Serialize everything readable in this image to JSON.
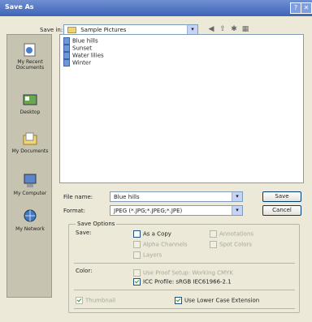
{
  "window": {
    "title": "Save As"
  },
  "toolbar": {
    "save_in_label": "Save in:",
    "save_in_value": "Sample Pictures"
  },
  "places": [
    {
      "label": "My Recent Documents",
      "icon": "recent-documents-icon"
    },
    {
      "label": "Desktop",
      "icon": "desktop-icon"
    },
    {
      "label": "My Documents",
      "icon": "my-documents-icon"
    },
    {
      "label": "My Computer",
      "icon": "my-computer-icon"
    },
    {
      "label": "My Network",
      "icon": "my-network-icon"
    }
  ],
  "files": [
    "Blue hills",
    "Sunset",
    "Water lilies",
    "Winter"
  ],
  "filename": {
    "label": "File name:",
    "value": "Blue hills"
  },
  "format": {
    "label": "Format:",
    "value": "JPEG (*.JPG;*.JPEG;*.JPE)"
  },
  "buttons": {
    "save": "Save",
    "cancel": "Cancel"
  },
  "save_options": {
    "title": "Save Options",
    "save_label": "Save:",
    "as_copy": "As a Copy",
    "annotations": "Annotations",
    "alpha_channels": "Alpha Channels",
    "spot_colors": "Spot Colors",
    "layers": "Layers"
  },
  "color": {
    "label": "Color:",
    "use_proof": "Use Proof Setup: Working CMYK",
    "icc_profile": "ICC Profile: sRGB IEC61966-2.1"
  },
  "bottom": {
    "thumbnail": "Thumbnail",
    "lower_case": "Use Lower Case Extension"
  }
}
